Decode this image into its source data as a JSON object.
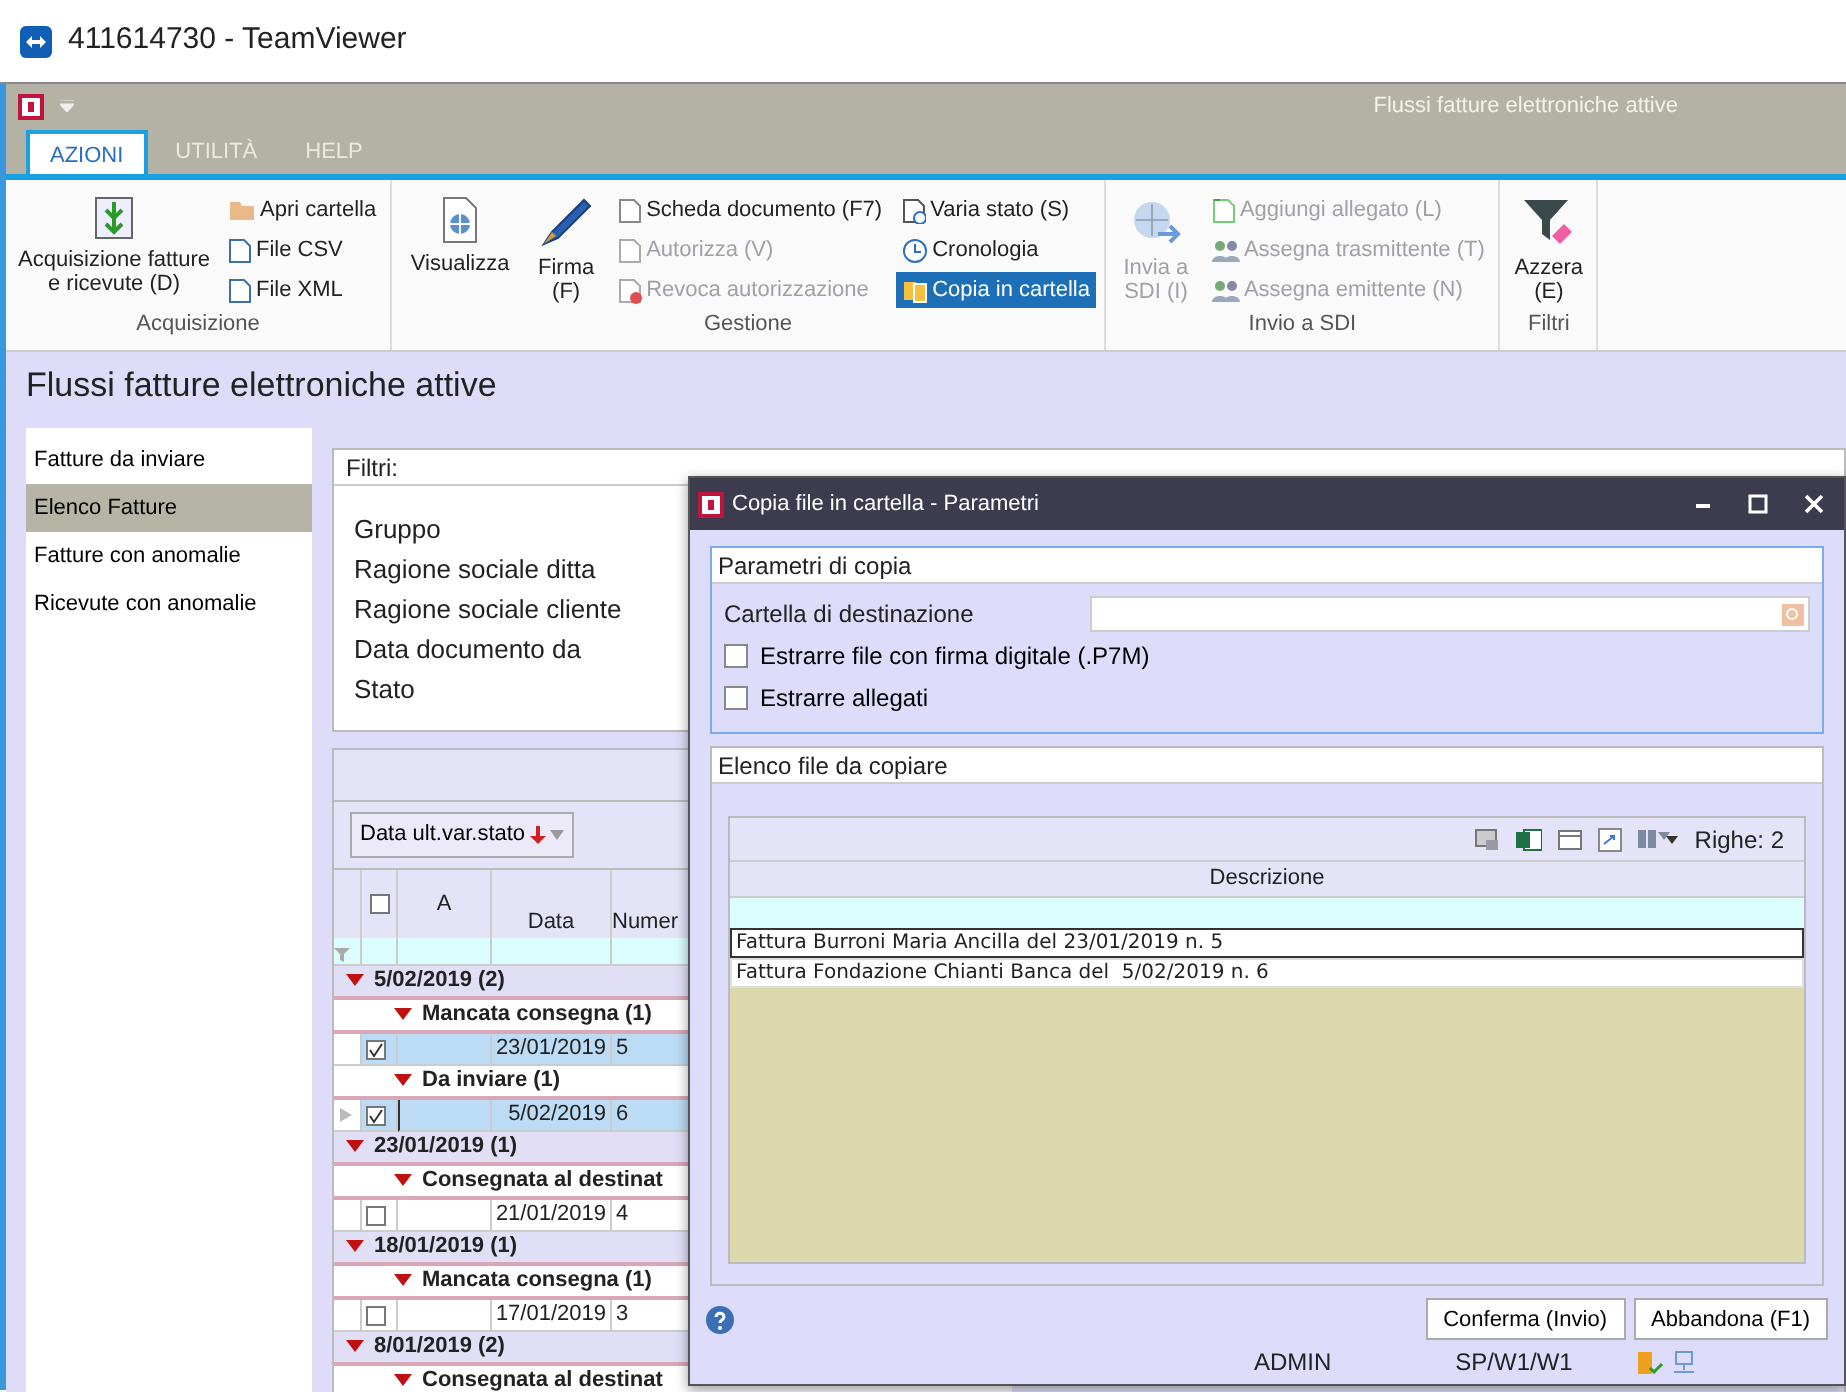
{
  "window": {
    "title": "411614730 - TeamViewer"
  },
  "app": {
    "title": "Flussi fatture elettroniche attive"
  },
  "tabs": [
    {
      "label": "AZIONI",
      "selected": true
    },
    {
      "label": "UTILITÀ",
      "selected": false
    },
    {
      "label": "HELP",
      "selected": false
    }
  ],
  "ribbon_groups": [
    {
      "label": "Acquisizione",
      "large": [
        {
          "label": "Acquisizione fatture e ricevute (D)",
          "disabled": false
        }
      ],
      "stacks": [
        [
          {
            "label": "Apri cartella",
            "disabled": false,
            "selected": false
          },
          {
            "label": "File CSV",
            "disabled": false,
            "selected": false
          },
          {
            "label": "File XML",
            "disabled": false,
            "selected": false
          }
        ]
      ]
    },
    {
      "label": "Gestione",
      "large": [
        {
          "label": "Visualizza",
          "disabled": false
        },
        {
          "label": "Firma (F)",
          "disabled": false
        }
      ],
      "stacks": [
        [
          {
            "label": "Scheda documento (F7)",
            "disabled": false,
            "selected": false
          },
          {
            "label": "Autorizza (V)",
            "disabled": true,
            "selected": false
          },
          {
            "label": "Revoca autorizzazione",
            "disabled": true,
            "selected": false
          }
        ],
        [
          {
            "label": "Varia stato (S)",
            "disabled": false,
            "selected": false
          },
          {
            "label": "Cronologia",
            "disabled": false,
            "selected": false
          },
          {
            "label": "Copia in cartella",
            "disabled": false,
            "selected": true
          }
        ]
      ]
    },
    {
      "label": "Invio a SDI",
      "large": [
        {
          "label": "Invia a SDI (I)",
          "disabled": true
        }
      ],
      "stacks": [
        [
          {
            "label": "Aggiungi allegato (L)",
            "disabled": true,
            "selected": false
          },
          {
            "label": "Assegna trasmittente (T)",
            "disabled": true,
            "selected": false
          },
          {
            "label": "Assegna emittente (N)",
            "disabled": true,
            "selected": false
          }
        ]
      ]
    },
    {
      "label": "Filtri",
      "large": [
        {
          "label": "Azzera (E)",
          "disabled": false
        }
      ]
    }
  ],
  "page_title": "Flussi fatture elettroniche attive",
  "sidebar": {
    "items": [
      {
        "label": "Fatture da inviare",
        "selected": false
      },
      {
        "label": "Elenco Fatture",
        "selected": true
      },
      {
        "label": "Fatture con anomalie",
        "selected": false
      },
      {
        "label": "Ricevute con anomalie",
        "selected": false
      }
    ]
  },
  "filters": {
    "title": "Filtri:",
    "labels": [
      "Gruppo",
      "Ragione sociale ditta",
      "Ragione sociale cliente",
      "Data documento da",
      "Stato"
    ]
  },
  "grid": {
    "sort_chip": "Data ult.var.stato",
    "header_checked": false,
    "columns": [
      "A",
      "Data",
      "Numer"
    ],
    "groups": [
      {
        "label": "5/02/2019 (2)",
        "expanded": true,
        "children": [
          {
            "label": "Mancata consegna (1)",
            "expanded": true,
            "rows": [
              {
                "date": "23/01/2019",
                "number": "5",
                "checked": true,
                "selected": true,
                "current": false
              }
            ]
          },
          {
            "label": "Da inviare (1)",
            "expanded": true,
            "rows": [
              {
                "date": "5/02/2019",
                "number": "6",
                "checked": true,
                "selected": true,
                "current": true
              }
            ]
          }
        ]
      },
      {
        "label": "23/01/2019 (1)",
        "expanded": true,
        "children": [
          {
            "label": "Consegnata al destinat",
            "expanded": true,
            "rows": [
              {
                "date": "21/01/2019",
                "number": "4",
                "checked": false,
                "selected": false,
                "current": false
              }
            ]
          }
        ]
      },
      {
        "label": "18/01/2019 (1)",
        "expanded": true,
        "children": [
          {
            "label": "Mancata consegna (1)",
            "expanded": true,
            "rows": [
              {
                "date": "17/01/2019",
                "number": "3",
                "checked": false,
                "selected": false,
                "current": false
              }
            ]
          }
        ]
      },
      {
        "label": "8/01/2019 (2)",
        "expanded": true,
        "children": [
          {
            "label": "Consegnata al destinat",
            "expanded": true
          }
        ]
      }
    ]
  },
  "dialog": {
    "title": "Copia file in cartella - Parametri",
    "params": {
      "title": "Parametri di copia",
      "field_label": "Cartella di destinazione",
      "options": [
        {
          "label": "Estrarre file con firma digitale (.P7M)",
          "checked": false
        },
        {
          "label": "Estrarre allegati",
          "checked": false
        }
      ]
    },
    "files": {
      "title": "Elenco file da copiare",
      "count": "Righe: 2",
      "column": "Descrizione",
      "rows": [
        {
          "text": "Fattura Burroni Maria Ancilla del 23/01/2019 n. 5",
          "selected": true
        },
        {
          "text": "Fattura Fondazione Chianti Banca del  5/02/2019 n. 6",
          "selected": false
        }
      ]
    },
    "buttons": [
      "Conferma (Invio)",
      "Abbandona (F1)"
    ],
    "status": [
      "ADMIN",
      "SP/W1/W1"
    ]
  }
}
